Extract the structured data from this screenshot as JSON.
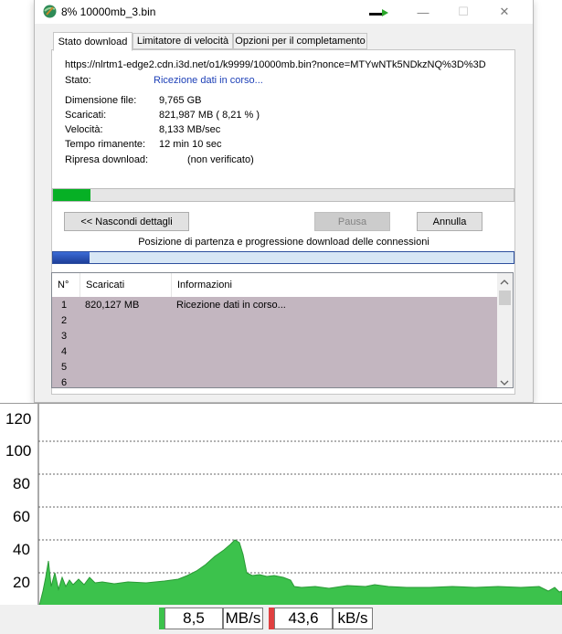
{
  "window": {
    "title": "8% 10000mb_3.bin",
    "buttons": {
      "minimize": "—",
      "maximize": "☐",
      "close": "✕"
    }
  },
  "tabs": [
    {
      "label": "Stato download",
      "active": true
    },
    {
      "label": "Limitatore di velocità",
      "active": false
    },
    {
      "label": "Opzioni per il completamento",
      "active": false
    }
  ],
  "details": {
    "url": "https://nlrtm1-edge2.cdn.i3d.net/o1/k9999/10000mb.bin?nonce=MTYwNTk5NDkzNQ%3D%3D",
    "status_label": "Stato:",
    "status_value": "Ricezione dati in corso...",
    "size_label": "Dimensione file:",
    "size_value": "9,765 GB",
    "downloaded_label": "Scaricati:",
    "downloaded_value": "821,987 MB ( 8,21 % )",
    "speed_label": "Velocità:",
    "speed_value": "8,133 MB/sec",
    "remaining_label": "Tempo rimanente:",
    "remaining_value": "12 min 10 sec",
    "resume_label": "Ripresa download:",
    "resume_value": "(non verificato)"
  },
  "progress": {
    "fraction": 0.0821
  },
  "buttons": {
    "hide_details": "<< Nascondi dettagli",
    "pause": "Pausa",
    "cancel": "Annulla"
  },
  "connections_caption": "Posizione di partenza e progressione download delle connessioni",
  "connections_progress": {
    "fraction": 0.08
  },
  "connections_table": {
    "headers": [
      "N°",
      "Scaricati",
      "Informazioni"
    ],
    "rows": [
      {
        "n": "1",
        "downloaded": "820,127 MB",
        "info": "Ricezione dati in corso..."
      },
      {
        "n": "2",
        "downloaded": "",
        "info": ""
      },
      {
        "n": "3",
        "downloaded": "",
        "info": ""
      },
      {
        "n": "4",
        "downloaded": "",
        "info": ""
      },
      {
        "n": "5",
        "downloaded": "",
        "info": ""
      },
      {
        "n": "6",
        "downloaded": "",
        "info": ""
      }
    ]
  },
  "speed_graph": {
    "y_ticks": [
      "120",
      "100",
      "80",
      "60",
      "40",
      "20"
    ],
    "fill_color": "#3cc24c"
  },
  "status_bar": {
    "download_speed": "8,5",
    "download_unit": "MB/s",
    "upload_speed": "43,6",
    "upload_unit": "kB/s",
    "download_color": "#3cc24c",
    "upload_color": "#e04040"
  }
}
